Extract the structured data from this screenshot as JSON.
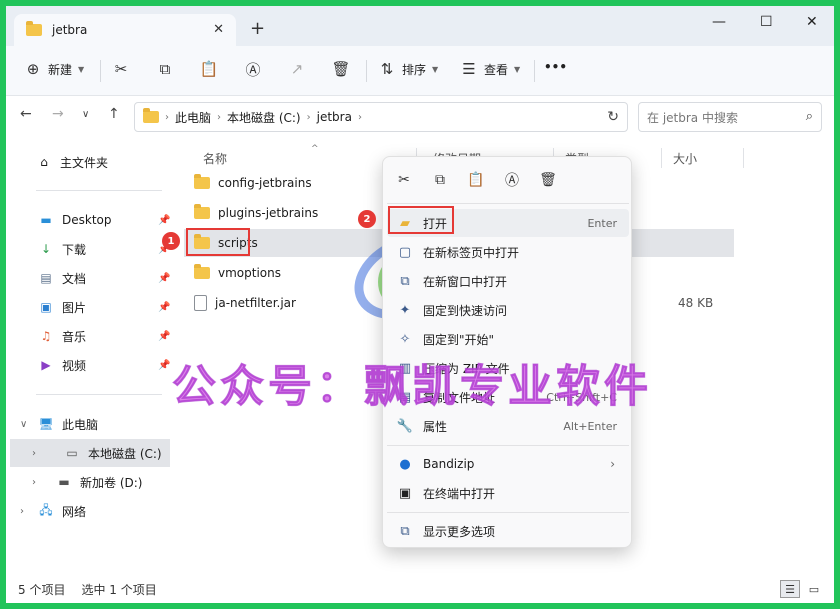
{
  "window": {
    "tab_title": "jetbra",
    "tab_close": "✕",
    "new_tab": "+",
    "minimize": "—",
    "maximize": "☐",
    "close": "✕"
  },
  "toolbar": {
    "new_label": "新建",
    "sort_label": "排序",
    "view_label": "查看",
    "more_label": "•••"
  },
  "address": {
    "crumbs": [
      "此电脑",
      "本地磁盘 (C:)",
      "jetbra"
    ],
    "search_placeholder": "在 jetbra 中搜索"
  },
  "sidebar": {
    "home": "主文件夹",
    "quick": [
      {
        "label": "Desktop",
        "icon": "desktop-icon"
      },
      {
        "label": "下载",
        "icon": "download-icon"
      },
      {
        "label": "文档",
        "icon": "document-icon"
      },
      {
        "label": "图片",
        "icon": "picture-icon"
      },
      {
        "label": "音乐",
        "icon": "music-icon"
      },
      {
        "label": "视频",
        "icon": "video-icon"
      }
    ],
    "this_pc": "此电脑",
    "drives": [
      {
        "label": "本地磁盘 (C:)"
      },
      {
        "label": "新加卷 (D:)"
      }
    ],
    "network": "网络"
  },
  "columns": {
    "name": "名称",
    "date": "修改日期",
    "type": "类型",
    "size": "大小"
  },
  "files": [
    {
      "name": "config-jetbrains",
      "kind": "folder",
      "size": ""
    },
    {
      "name": "plugins-jetbrains",
      "kind": "folder",
      "size": ""
    },
    {
      "name": "scripts",
      "kind": "folder",
      "size": ""
    },
    {
      "name": "vmoptions",
      "kind": "folder",
      "size": ""
    },
    {
      "name": "ja-netfilter.jar",
      "kind": "file",
      "size": "48 KB"
    }
  ],
  "badges": {
    "one": "1",
    "two": "2"
  },
  "context_menu": {
    "items": [
      {
        "label": "打开",
        "shortcut": "Enter",
        "icon": "open-folder-icon"
      },
      {
        "label": "在新标签页中打开",
        "shortcut": "",
        "icon": "new-tab-icon"
      },
      {
        "label": "在新窗口中打开",
        "shortcut": "",
        "icon": "new-window-icon"
      },
      {
        "label": "固定到快速访问",
        "shortcut": "",
        "icon": "pin-icon"
      },
      {
        "label": "固定到\"开始\"",
        "shortcut": "",
        "icon": "pin-start-icon"
      },
      {
        "label": "压缩为 ZIP 文件",
        "shortcut": "",
        "icon": "zip-icon"
      },
      {
        "label": "复制文件地址",
        "shortcut": "Ctrl+Shift+C",
        "icon": "copy-path-icon"
      },
      {
        "label": "属性",
        "shortcut": "Alt+Enter",
        "icon": "wrench-icon"
      },
      {
        "label": "Bandizip",
        "shortcut": "",
        "icon": "bandizip-icon"
      },
      {
        "label": "在终端中打开",
        "shortcut": "",
        "icon": "terminal-icon"
      },
      {
        "label": "显示更多选项",
        "shortcut": "",
        "icon": "more-options-icon"
      }
    ]
  },
  "status": {
    "count": "5 个项目",
    "selected": "选中 1 个项目"
  },
  "watermark": "公众号：飘凯专业软件"
}
